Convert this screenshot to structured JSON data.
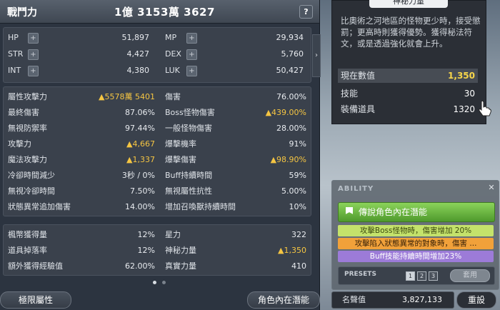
{
  "header": {
    "combat_label": "戰鬥力",
    "combat_value": "1億 3153萬 3627",
    "help": "?"
  },
  "primary_stats": [
    {
      "label": "HP",
      "value": "51,897",
      "label2": "MP",
      "value2": "29,934"
    },
    {
      "label": "STR",
      "value": "4,427",
      "label2": "DEX",
      "value2": "5,760"
    },
    {
      "label": "INT",
      "value": "4,380",
      "label2": "LUK",
      "value2": "50,427"
    }
  ],
  "detail_stats": [
    {
      "label": "屬性攻擊力",
      "value": "5578萬 5401",
      "label2": "傷害",
      "value2": "76.00%"
    },
    {
      "label": "最終傷害",
      "value": "87.06%",
      "label2": "Boss怪物傷害",
      "value2": "439.00%"
    },
    {
      "label": "無視防禦率",
      "value": "97.44%",
      "label2": "一般怪物傷害",
      "value2": "28.00%"
    },
    {
      "label": "攻擊力",
      "value": "4,667",
      "label2": "爆擊機率",
      "value2": "91%"
    },
    {
      "label": "魔法攻擊力",
      "value": "1,337",
      "label2": "爆擊傷害",
      "value2": "98.90%"
    },
    {
      "label": "冷卻時間減少",
      "value": "3秒 / 0%",
      "label2": "Buff持續時間",
      "value2": "59%"
    },
    {
      "label": "無視冷卻時間",
      "value": "7.50%",
      "label2": "無視屬性抗性",
      "value2": "5.00%"
    },
    {
      "label": "狀態異常追加傷害",
      "value": "14.00%",
      "label2": "增加召喚獸持續時間",
      "value2": "10%"
    }
  ],
  "misc_stats": [
    {
      "label": "楓幣獲得量",
      "value": "12%",
      "label2": "星力",
      "value2": "322"
    },
    {
      "label": "道具掉落率",
      "value": "12%",
      "label2": "神秘力量",
      "value2": "1,350"
    },
    {
      "label": "額外獲得經驗值",
      "value": "62.00%",
      "label2": "真實力量",
      "value2": "410"
    }
  ],
  "buttons": {
    "limit_attr": "極限屬性",
    "inner_ability": "角色內在潛能",
    "reset": "重設"
  },
  "tooltip": {
    "title": "神秘力量",
    "desc": "比奧術之河地區的怪物更少時，接受懲罰；更高時則獲得優勢。獲得秘法符文，或是透過強化就會上升。",
    "rows": [
      {
        "k": "現在數值",
        "v": "1,350"
      },
      {
        "k": "技能",
        "v": "30"
      },
      {
        "k": "裝備道具",
        "v": "1320"
      }
    ]
  },
  "ability": {
    "header": "ABILITY",
    "close": "✕",
    "legend": "傳說角色內在潛能",
    "lines": [
      "攻擊Boss怪物時，傷害增加 20%",
      "攻擊陷入狀態異常的對象時，傷害 ...",
      "Buff技能持續時間增加23%"
    ],
    "presets_label": "PRESETS",
    "presets": [
      "1",
      "2",
      "3"
    ],
    "use": "套用"
  },
  "fame": {
    "label": "名聲值",
    "value": "3,827,133"
  },
  "colors": {
    "highlight": "#f5c542",
    "legend_green": "#6fb544",
    "line_orange": "#f1a13a",
    "line_purple": "#9c7bd8"
  }
}
